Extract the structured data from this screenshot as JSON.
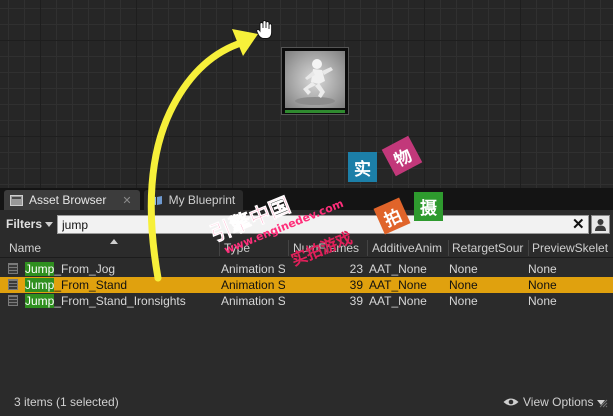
{
  "tabs": [
    {
      "label": "Asset Browser",
      "close": "✕"
    },
    {
      "label": "My Blueprint"
    }
  ],
  "filters": {
    "label": "Filters",
    "search_value": "jump",
    "clear_glyph": "✕"
  },
  "columns": [
    "Name",
    "Type",
    "NumFrames",
    "AdditiveAnim",
    "RetargetSour",
    "PreviewSkelet"
  ],
  "assets": [
    {
      "match": "Jump",
      "rest": "_From_Jog",
      "type": "Animation S",
      "frames": "23",
      "additive": "AAT_None",
      "retarget": "None",
      "preview": "None",
      "selected": false
    },
    {
      "match": "Jump",
      "rest": "_From_Stand",
      "type": "Animation S",
      "frames": "39",
      "additive": "AAT_None",
      "retarget": "None",
      "preview": "None",
      "selected": true
    },
    {
      "match": "Jump",
      "rest": "_From_Stand_Ironsights",
      "type": "Animation S",
      "frames": "39",
      "additive": "AAT_None",
      "retarget": "None",
      "preview": "None",
      "selected": false
    }
  ],
  "status": {
    "count_text": "3 items (1 selected)",
    "view_options": "View Options"
  },
  "watermark": {
    "line1": "引擎中国",
    "url": "www.enginedev.com",
    "line3": "实拍游戏",
    "tiles": [
      {
        "char": "实",
        "color": "#1c7fa8"
      },
      {
        "char": "物",
        "color": "#c2387a"
      },
      {
        "char": "拍",
        "color": "#e0642a"
      },
      {
        "char": "摄",
        "color": "#2e9a2e"
      }
    ]
  },
  "colors": {
    "selection": "#e0a10e",
    "match_highlight": "#2f8f1f",
    "arrow": "#f7f03a"
  }
}
